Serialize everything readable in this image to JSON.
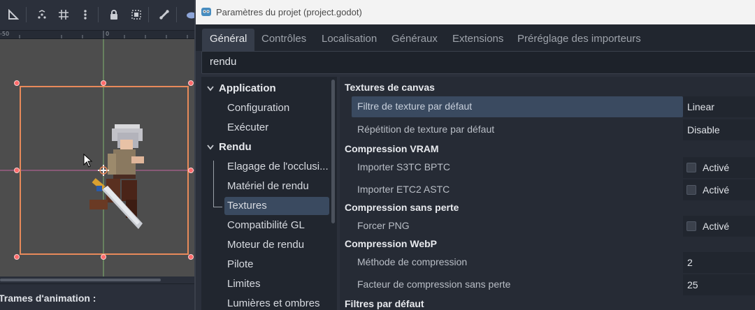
{
  "editor": {
    "ruler_labels": [
      "-50",
      "0"
    ],
    "toolbar_icons": [
      "ruler-icon",
      "smart-snap-icon",
      "grid-snap-icon",
      "more-icon",
      "lock-icon",
      "group-icon",
      "bone-icon",
      "cloud-icon"
    ],
    "animation_label": "Trames d'animation :"
  },
  "dialog": {
    "title": "Paramètres du projet (project.godot)",
    "tabs": [
      {
        "label": "Général",
        "active": true
      },
      {
        "label": "Contrôles"
      },
      {
        "label": "Localisation"
      },
      {
        "label": "Généraux"
      },
      {
        "label": "Extensions"
      },
      {
        "label": "Préréglage des importeurs"
      }
    ],
    "search_value": "rendu",
    "tree": {
      "sections": [
        {
          "label": "Application",
          "items": [
            "Configuration",
            "Exécuter"
          ]
        },
        {
          "label": "Rendu",
          "items": [
            "Elagage de l'occlusi...",
            "Matériel de rendu",
            "Textures",
            "Compatibilité GL",
            "Moteur de rendu",
            "Pilote",
            "Limites",
            "Lumières et ombres"
          ]
        }
      ],
      "selected": "Textures"
    },
    "inspector": {
      "categories": [
        {
          "label": "Textures de canvas",
          "props": [
            {
              "label": "Filtre de texture par défaut",
              "value": "Linear",
              "highlight": true
            },
            {
              "label": "Répétition de texture par défaut",
              "value": "Disable"
            }
          ]
        },
        {
          "label": "Compression VRAM",
          "props": [
            {
              "label": "Importer S3TC BPTC",
              "check": "Activé"
            },
            {
              "label": "Importer ETC2 ASTC",
              "check": "Activé"
            }
          ]
        },
        {
          "label": "Compression sans perte",
          "props": [
            {
              "label": "Forcer PNG",
              "check": "Activé"
            }
          ]
        },
        {
          "label": "Compression WebP",
          "props": [
            {
              "label": "Méthode de compression",
              "value": "2"
            },
            {
              "label": "Facteur de compression sans perte",
              "value": "25"
            }
          ]
        },
        {
          "label": "Filtres par défaut",
          "props": []
        }
      ]
    }
  },
  "colors": {
    "selection": "#3a4a60",
    "dialog_bg": "#2b303b",
    "selection_rect": "#e88a5a",
    "handle": "#ff5a5a"
  }
}
